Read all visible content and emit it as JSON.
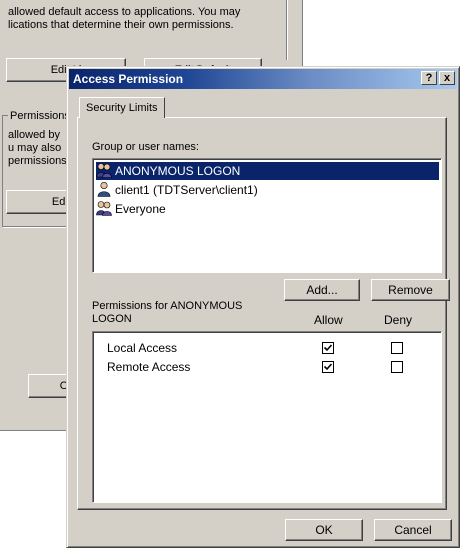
{
  "background_window": {
    "text_line1": "allowed default access to applications. You may",
    "text_line2": "lications that determine their own permissions.",
    "edit_limits_button": "Edit Li",
    "edit_default_button": "Edit Default",
    "group_label": "Permissions",
    "text_line3": "allowed by",
    "text_line4": "u may also",
    "text_line5": "permissions",
    "edit_button_2": "Edit L",
    "bottom_button": "O"
  },
  "dialog": {
    "title": "Access Permission",
    "help_button": "?",
    "close_button": "x",
    "tab_label": "Security Limits",
    "group_label": "Group or user names:",
    "users": [
      {
        "name": "ANONYMOUS LOGON",
        "icon": "group-users-icon",
        "selected": true
      },
      {
        "name": "client1 (TDTServer\\client1)",
        "icon": "user-icon",
        "selected": false
      },
      {
        "name": "Everyone",
        "icon": "group-users-icon",
        "selected": false
      }
    ],
    "add_button": "Add...",
    "remove_button": "Remove",
    "permissions_label_line1": "Permissions for ANONYMOUS",
    "permissions_label_line2": "LOGON",
    "allow_header": "Allow",
    "deny_header": "Deny",
    "permissions": [
      {
        "name": "Local Access",
        "allow": true,
        "deny": false
      },
      {
        "name": "Remote Access",
        "allow": true,
        "deny": false
      }
    ],
    "ok_button": "OK",
    "cancel_button": "Cancel"
  },
  "colors": {
    "face": "#d4d0c8",
    "selection": "#0a246a",
    "title_start": "#0a246a",
    "title_end": "#a6caf0"
  }
}
